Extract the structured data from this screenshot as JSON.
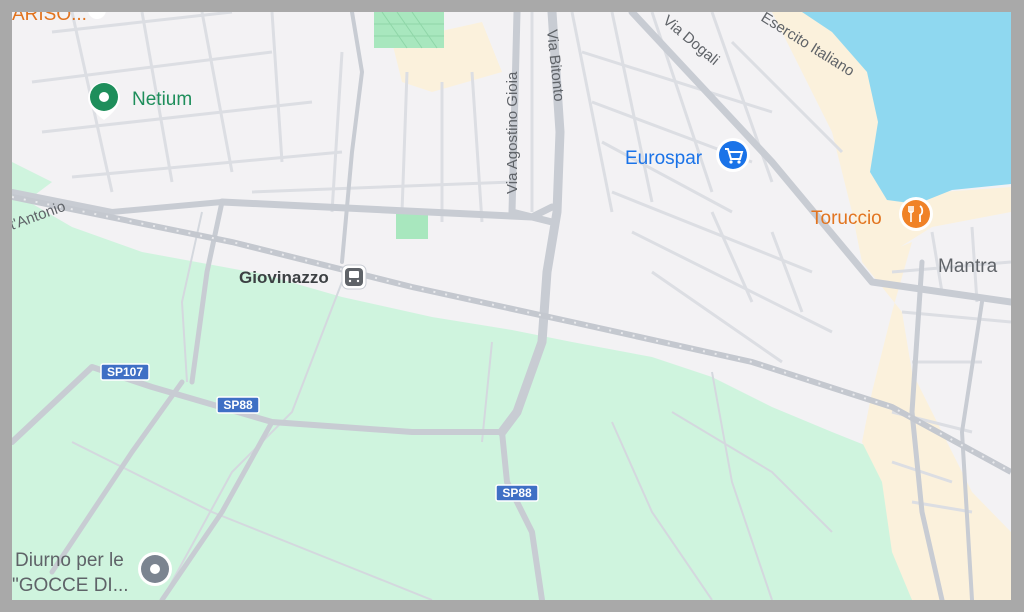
{
  "map": {
    "pois": {
      "top_cut": "ARISO...",
      "netium": "Netium",
      "eurospar": "Eurospar",
      "toruccio": "Toruccio",
      "mantra": "Mantra",
      "giovinazzo": "Giovinazzo",
      "diurno_line1": "Diurno per le",
      "diurno_line2": "\"GOCCE DI..."
    },
    "streets": {
      "gioia": "Via Agostino Gioia",
      "bitonto": "Via Bitonto",
      "dogali": "Via Dogali",
      "esercito": "Esercito Italiano",
      "antonio": "t'Antonio"
    },
    "shields": {
      "sp107": "SP107",
      "sp88_a": "SP88",
      "sp88_b": "SP88"
    },
    "icons": {
      "netium": "map-pin-icon",
      "eurospar": "shopping-cart-icon",
      "toruccio": "restaurant-icon",
      "giovinazzo": "train-station-icon",
      "diurno": "map-pin-icon"
    },
    "colors": {
      "land": "#f3f2f4",
      "park": "#cdf3dc",
      "water": "#8fd8f0",
      "beach": "#fbf1dc",
      "road": "#c8ccd3",
      "shield": "#3f6fc5",
      "green_pin": "#1e8e5b",
      "blue_poi": "#1a73e8",
      "orange_poi": "#f08227"
    }
  }
}
